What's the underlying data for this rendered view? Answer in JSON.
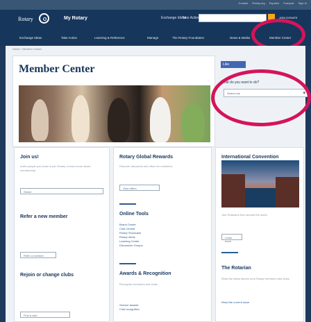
{
  "utility": {
    "items": [
      "Contact",
      "Rotary.org",
      "Español",
      "Français",
      "Sign In"
    ]
  },
  "header": {
    "logo": "Rotary",
    "site": "My Rotary",
    "links": [
      "Exchange Ideas",
      "Take Action"
    ],
    "join": "JOIN DONATE"
  },
  "nav": {
    "items": [
      "Exchange Ideas",
      "Take Action",
      "Learning & Reference",
      "Manage",
      "The Rotary Foundation",
      "News & Media",
      "Member Center"
    ]
  },
  "breadcrumb": "Home › Member Center",
  "hero": {
    "title": "Member Center"
  },
  "sidebar": {
    "facebook": "Like",
    "question": "What do you want to do?",
    "select": "Select one"
  },
  "columns": {
    "join_us": {
      "title": "Join us!",
      "text": "Invite people you know to join Rotary or learn more about membership.",
      "dropdown": "Select",
      "refer": "Refer a new member",
      "refer_btn": "Refer a member",
      "rejoin": "Rejoin or change clubs",
      "rejoin_btn": "Find a club"
    },
    "rewards": {
      "title": "Rotary Global Rewards",
      "text": "Discover discounts and offers for members.",
      "btn": "View offers",
      "tools": "Online Tools",
      "links": [
        "Brand Center",
        "Club Central",
        "Rotary Showcase",
        "Rotary Ideas",
        "Learning Center",
        "Discussion Groups"
      ],
      "awards": "Awards & Recognition",
      "awards_text": "Recognize members and clubs.",
      "award_links": [
        "Service awards",
        "Club recognition"
      ]
    },
    "convention": {
      "title": "International Convention",
      "text": "Join Rotarians from around the world.",
      "btn": "Learn more",
      "rotarian": "The Rotarian",
      "rotarian_text": "Read the latest stories from Rotary members and clubs.",
      "rotarian_link": "Read the current issue"
    }
  }
}
